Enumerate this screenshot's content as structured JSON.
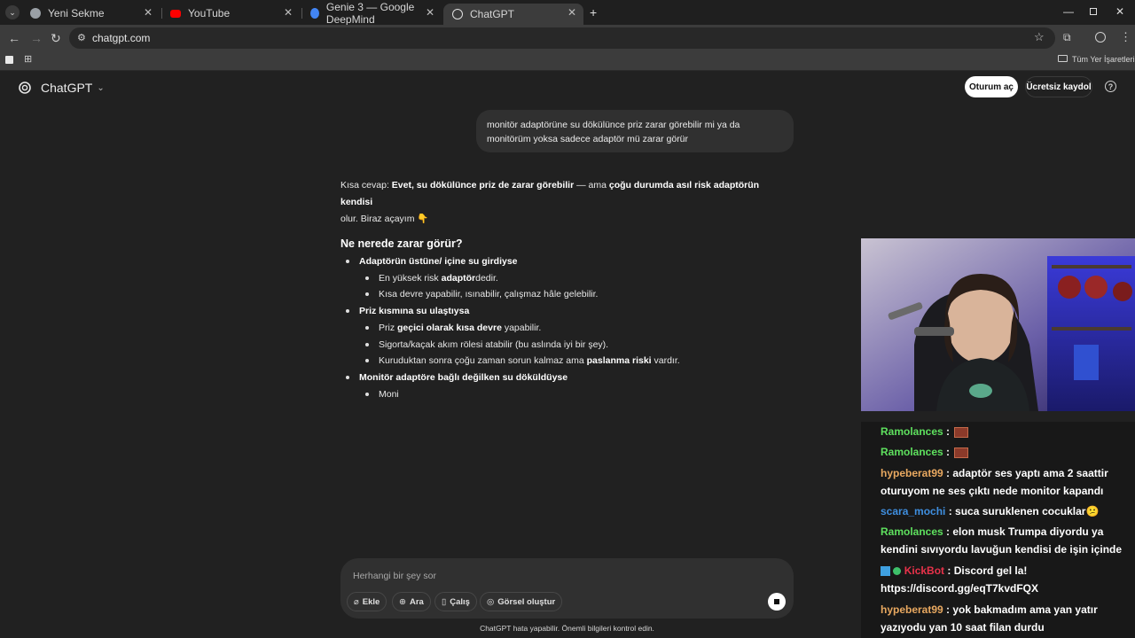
{
  "browser": {
    "tabs": [
      {
        "label": "Yeni Sekme",
        "color": "#9aa0a6"
      },
      {
        "label": "YouTube",
        "color": "#ff0000"
      },
      {
        "label": "Genie 3 — Google DeepMind",
        "color": "#4285f4"
      },
      {
        "label": "ChatGPT",
        "color": "#e0e0e0"
      }
    ],
    "url": "chatgpt.com",
    "bookmarks_label": "Tüm Yer İşaretleri"
  },
  "chatgpt": {
    "brand": "ChatGPT",
    "login_label": "Oturum aç",
    "signup_label": "Ücretsiz kaydol",
    "user_message": "monitör adaptörüne su dökülünce priz zarar görebilir mi ya da monitörüm yoksa sadece adaptör mü zarar görür",
    "answer": {
      "intro_prefix": "Kısa cevap: ",
      "intro_bold1": "Evet, su dökülünce priz de zarar görebilir",
      "intro_mid": " — ama ",
      "intro_bold2": "çoğu durumda asıl risk adaptörün kendisi",
      "intro_line2": "olur. Biraz açayım 👇",
      "heading": "Ne nerede zarar görür?",
      "item1_title": "Adaptörün üstüne/ içine su girdiyse",
      "item1_sub1_pre": "En yüksek risk ",
      "item1_sub1_bold": "adaptör",
      "item1_sub1_post": "dedir.",
      "item1_sub2": "Kısa devre yapabilir, ısınabilir, çalışmaz hâle gelebilir.",
      "item2_title": "Priz kısmına su ulaştıysa",
      "item2_sub1_pre": "Priz ",
      "item2_sub1_bold": "geçici olarak kısa devre",
      "item2_sub1_post": " yapabilir.",
      "item2_sub2": "Sigorta/kaçak akım rölesi atabilir (bu aslında iyi bir şey).",
      "item2_sub3_pre": "Kuruduktan sonra çoğu zaman sorun kalmaz ama ",
      "item2_sub3_bold": "paslanma riski",
      "item2_sub3_post": " vardır.",
      "item3_title": "Monitör adaptöre bağlı değilken su döküldüyse",
      "item3_sub1": "Moni"
    },
    "composer": {
      "placeholder": "Herhangi bir şey sor",
      "btn_add": "Ekle",
      "btn_search": "Ara",
      "btn_study": "Çalış",
      "btn_image": "Görsel oluştur"
    },
    "disclaimer": "ChatGPT hata yapabilir. Önemli bilgileri kontrol edin."
  },
  "stream_chat": [
    {
      "user": "Ramolances",
      "color": "#5ee05e",
      "text": " : ",
      "emote": true
    },
    {
      "user": "Ramolances",
      "color": "#5ee05e",
      "text": " : ",
      "emote": true
    },
    {
      "user": "hypeberat99",
      "color": "#e8a860",
      "text": " : adaptör ses yaptı ama 2 saattir oturuyom ne ses çıktı nede monitor kapandı"
    },
    {
      "user": "scara_mochi",
      "color": "#3f8fe0",
      "text": " : suca suruklenen cocuklar😕"
    },
    {
      "user": "Ramolances",
      "color": "#5ee05e",
      "text": " : elon musk Trumpa diyordu ya kendini sıvıyordu lavuğun kendisi de işin içinde"
    },
    {
      "user": "KickBot",
      "color": "#e8324a",
      "text": " : Discord gel la! https://discord.gg/eqT7kvdFQX"
    },
    {
      "user": "hypeberat99",
      "color": "#e8a860",
      "text": " : yok bakmadım ama yan yatır yazıyodu yan 10 saat filan durdu"
    }
  ]
}
